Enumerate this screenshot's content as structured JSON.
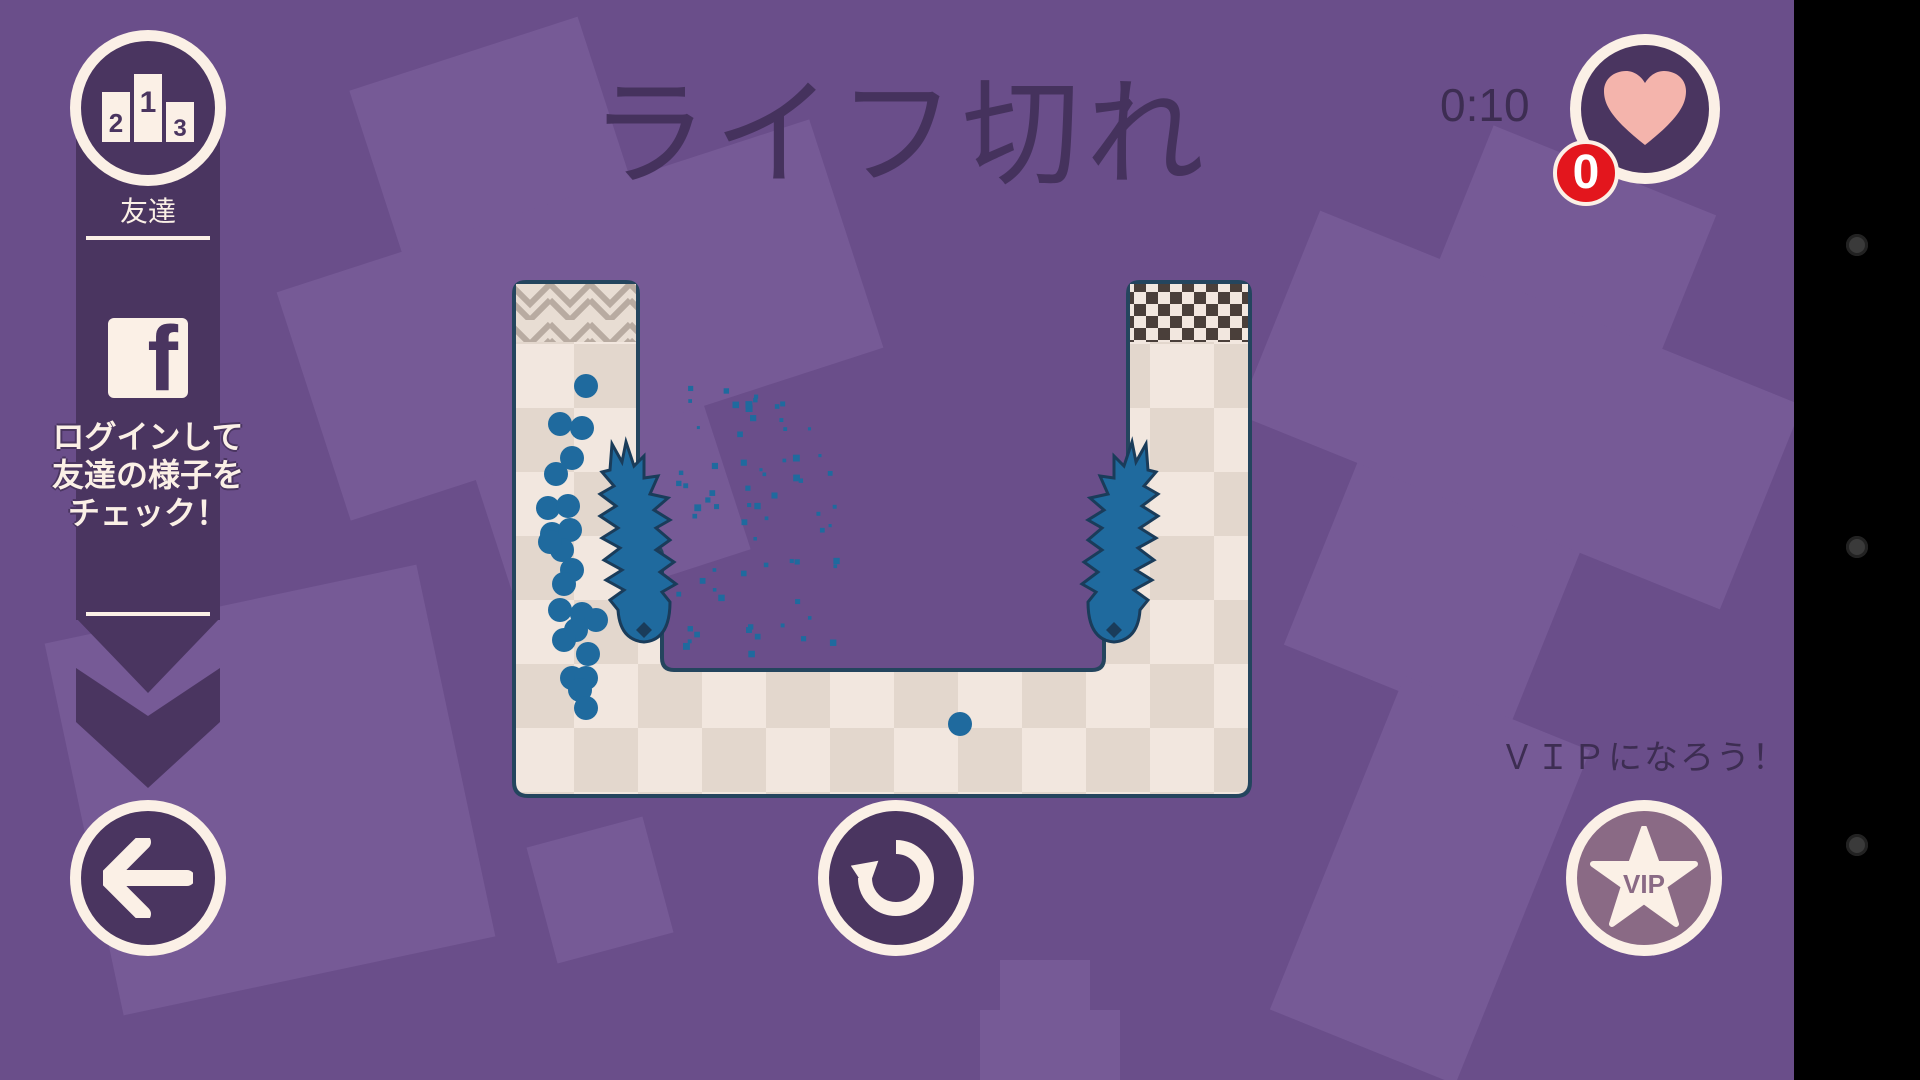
{
  "header": {
    "title": "ライフ切れ",
    "timer": "0:10",
    "lives_count": "0"
  },
  "sidebar": {
    "leaderboard_label": "友達",
    "facebook_letter": "f",
    "login_prompt": "ログインして\n友達の様子を\nチェック！"
  },
  "vip": {
    "prompt": "ＶＩＰになろう！",
    "badge_text": "VIP"
  },
  "colors": {
    "background": "#6a4e8a",
    "button_ring": "#fbf0e6",
    "button_fill": "#4a3560",
    "heart": "#f4b4ac",
    "lives_badge": "#e3161d",
    "ball": "#1f6a9e"
  },
  "icons": {
    "leaderboard": "podium-icon",
    "facebook": "facebook-icon",
    "back": "arrow-left-icon",
    "restart": "restart-icon",
    "vip": "star-vip-icon",
    "lives": "heart-icon"
  }
}
